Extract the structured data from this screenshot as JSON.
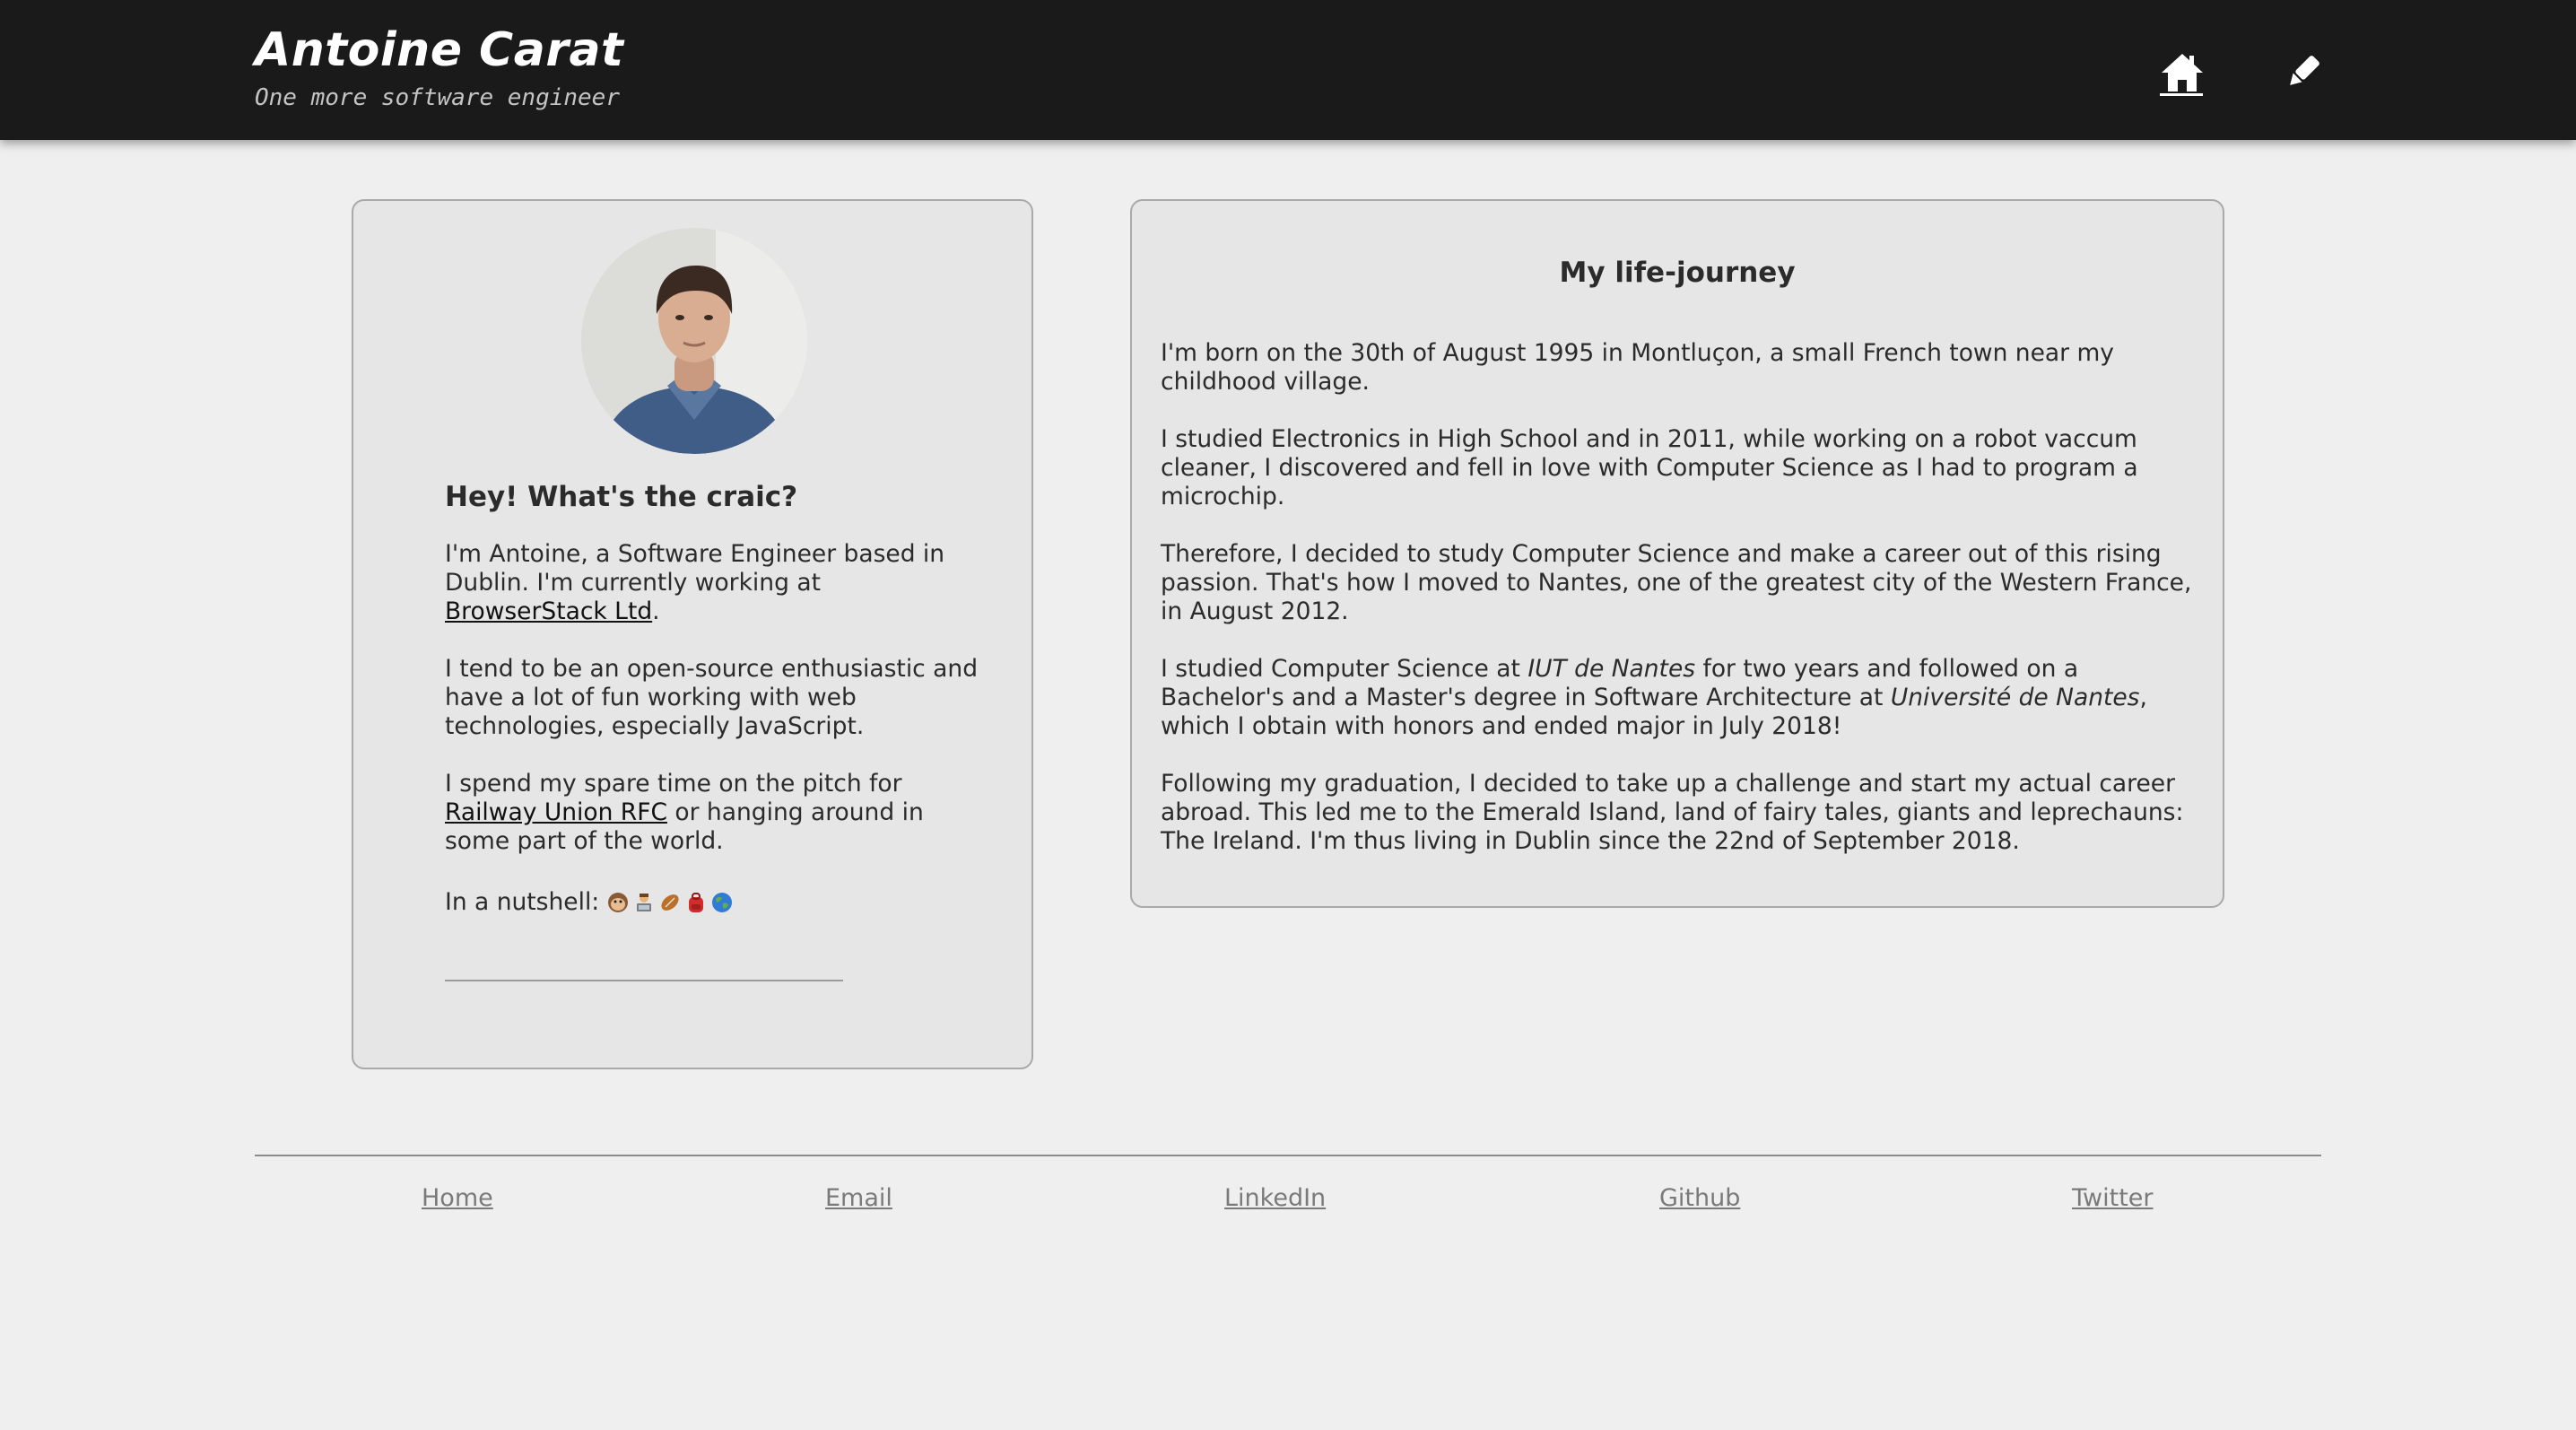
{
  "header": {
    "title": "Antoine Carat",
    "subtitle": "One more software engineer",
    "nav": [
      {
        "icon": "home-icon",
        "label": "Home"
      },
      {
        "icon": "pen-icon",
        "label": "Blog"
      }
    ]
  },
  "profile": {
    "avatar_alt": "Portrait of Antoine Carat",
    "greeting": "Hey! What's the craic?",
    "p1_before": "I'm Antoine, a Software Engineer based in Dublin. I'm currently working at ",
    "p1_link": "BrowserStack Ltd",
    "p1_after": ".",
    "p2": "I tend to be an open-source enthusiastic and have a lot of fun working with web technologies, especially JavaScript.",
    "p3_before": "I spend my spare time on the pitch for ",
    "p3_link": "Railway Union RFC",
    "p3_after": " or hanging around in some part of the world.",
    "nutshell_label": "In a nutshell: ",
    "nutshell_emojis": [
      "monkey-face-icon",
      "technologist-icon",
      "rugby-ball-icon",
      "backpack-icon",
      "globe-icon"
    ]
  },
  "journey": {
    "title": "My life-journey",
    "p1": "I'm born on the 30th of August 1995 in Montluçon, a small French town near my childhood village.",
    "p2": "I studied Electronics in High School and in 2011, while working on a robot vaccum cleaner, I discovered and fell in love with Computer Science as I had to program a microchip.",
    "p3": "Therefore, I decided to study Computer Science and make a career out of this rising passion. That's how I moved to Nantes, one of the greatest city of the Western France, in August 2012.",
    "p4_a": "I studied Computer Science at ",
    "p4_b": "IUT de Nantes",
    "p4_c": " for two years and followed on a Bachelor's and a Master's degree in Software Architecture at ",
    "p4_d": "Université de Nantes",
    "p4_e": ", which I obtain with honors and ended major in July 2018!",
    "p5": "Following my graduation, I decided to take up a challenge and start my actual career abroad. This led me to the Emerald Island, land of fairy tales, giants and leprechauns: The Ireland. I'm thus living in Dublin since the 22nd of September 2018."
  },
  "footer": {
    "links": [
      "Home",
      "Email",
      "LinkedIn",
      "Github",
      "Twitter"
    ]
  },
  "colors": {
    "topbar": "#1a1a1a",
    "page_bg": "#efefef",
    "card_bg": "#e6e6e6",
    "footer_link": "#7a7a7a"
  }
}
